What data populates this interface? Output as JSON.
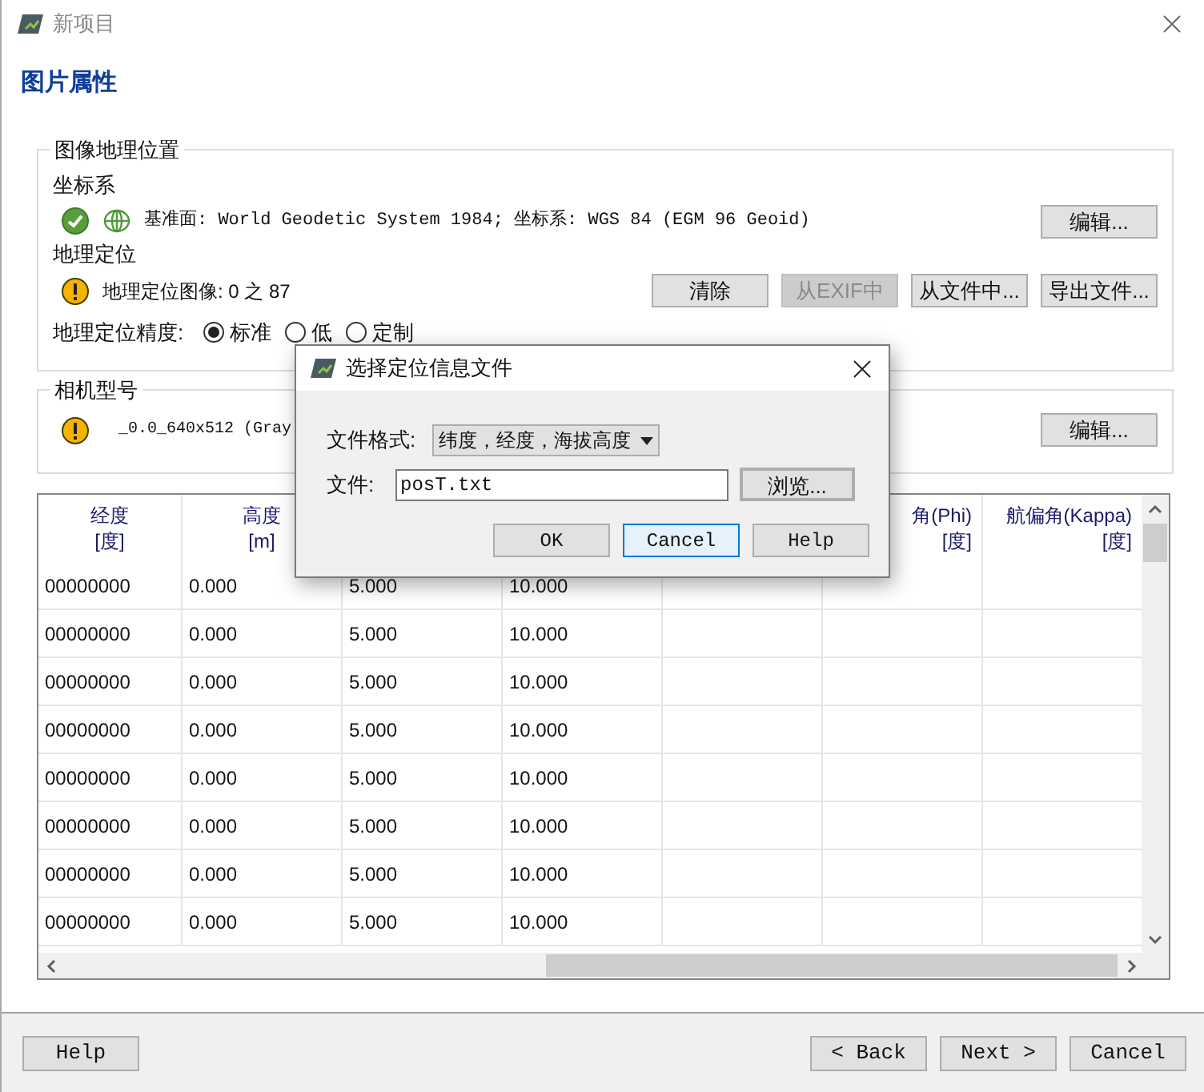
{
  "window": {
    "title": "新项目"
  },
  "page_title": "图片属性",
  "geo_group": {
    "title": "图像地理位置",
    "crs_label": "坐标系",
    "crs_valid": true,
    "crs_text": "基准面: World Geodetic System 1984; 坐标系: WGS 84 (EGM 96 Geoid)",
    "crs_button": "编辑...",
    "georef_label": "地理定位",
    "georef_complete": false,
    "georef_text": "地理定位图像: 0 之 87",
    "georef_buttons": [
      {
        "label": "清除",
        "disabled": false
      },
      {
        "label": "从EXIF中",
        "disabled": true
      },
      {
        "label": "从文件中...",
        "disabled": false
      },
      {
        "label": "导出文件...",
        "disabled": false
      }
    ],
    "accuracy_label": "地理定位精度:",
    "accuracy_options": [
      {
        "label": "标准",
        "selected": true
      },
      {
        "label": "低",
        "selected": false
      },
      {
        "label": "定制",
        "selected": false
      }
    ]
  },
  "camera_group": {
    "title": "相机型号",
    "valid": false,
    "text": "_0.0_640x512 (Gray",
    "button": "编辑..."
  },
  "table": {
    "columns": [
      {
        "label": "经度",
        "unit": "[度]"
      },
      {
        "label": "高度",
        "unit": "[m]"
      },
      {},
      {},
      {},
      {
        "label": "角(Phi)",
        "unit": "[度]"
      },
      {
        "label": "航偏角(Kappa)",
        "unit": "[度]"
      }
    ],
    "rows": [
      {
        "cells": [
          "00000000",
          "0.000",
          "5.000",
          "10.000"
        ]
      },
      {
        "cells": [
          "00000000",
          "0.000",
          "5.000",
          "10.000"
        ]
      },
      {
        "cells": [
          "00000000",
          "0.000",
          "5.000",
          "10.000"
        ]
      },
      {
        "cells": [
          "00000000",
          "0.000",
          "5.000",
          "10.000"
        ]
      },
      {
        "cells": [
          "00000000",
          "0.000",
          "5.000",
          "10.000"
        ]
      },
      {
        "cells": [
          "00000000",
          "0.000",
          "5.000",
          "10.000"
        ]
      },
      {
        "cells": [
          "00000000",
          "0.000",
          "5.000",
          "10.000"
        ]
      },
      {
        "cells": [
          "00000000",
          "0.000",
          "5.000",
          "10.000"
        ]
      }
    ]
  },
  "footer": {
    "help": "Help",
    "nav": [
      "< Back",
      "Next >",
      "Cancel"
    ]
  },
  "dialog": {
    "title": "选择定位信息文件",
    "format_label": "文件格式:",
    "format_value": "纬度，经度，海拔高度",
    "file_label": "文件:",
    "file_value": "posT.txt",
    "browse_button": "浏览...",
    "buttons": [
      {
        "label": "OK",
        "default": false
      },
      {
        "label": "Cancel",
        "default": true
      },
      {
        "label": "Help",
        "default": false
      }
    ]
  }
}
